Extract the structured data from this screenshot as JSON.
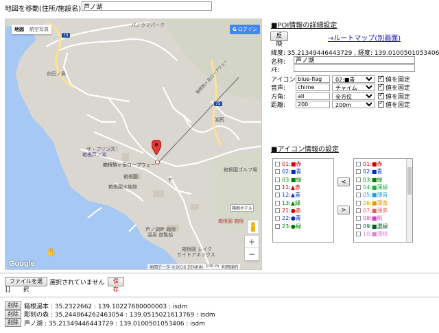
{
  "search": {
    "label": "地図を移動(住所/施設名):",
    "value": "芦ノ湖"
  },
  "map": {
    "type_buttons": [
      "地図",
      "航空写真"
    ],
    "login_label": "ログイン",
    "labels": {
      "panorama": "パノラマパーク",
      "road75a": "75",
      "road75b": "75",
      "wadanohana": "和田ノ鼻",
      "ropeway1": "箱根駒ヶ岳ロープウェー",
      "ropeway2": "箱根駒ヶ岳ロープウェー",
      "kojiri": "湖尻",
      "hotel1": "ザ・プリンス",
      "hotel2": "箱根芦ノ湖",
      "parking": "P",
      "hakonen": "箱根園",
      "aquarium": "箱根園水族館",
      "golf": "箱根園ゴルフ場",
      "hotel_hakone": "箱根ホテル",
      "keiyu": "箱根園 箱根",
      "ashinoko_onsen1": "芦ノ湖畔 箱根",
      "ashinoko_onsen2": "温泉 遊覧船",
      "lake_side1": "箱根園 レイク",
      "lake_side2": "サイドアネックス"
    },
    "zoom_in": "+",
    "zoom_out": "−",
    "google": "Google",
    "copyright": "地図データ ©2016 ZENRIN",
    "scale": "100 m",
    "terms": "利用規約",
    "pin_color": "#e53935"
  },
  "poi": {
    "title": "■POI情報の詳細設定",
    "apply_label": "反映",
    "route_link": "→ルートマップ(別画面)",
    "coords": "緯度: 35.21349446443729 , 経度: 139.0100501053406",
    "name_label": "名称:",
    "name_value": "芦ノ湖",
    "memo_label": "ﾒﾓ:",
    "memo_value": "",
    "rows": [
      {
        "label": "アイコン:",
        "input": "blue-flag",
        "select": "02:■青",
        "fix": "値を固定"
      },
      {
        "label": "音声:",
        "input": "chime",
        "select": "チャイム",
        "fix": "値を固定"
      },
      {
        "label": "方角:",
        "input": "all",
        "select": "全方位",
        "fix": "値を固定"
      },
      {
        "label": "距離:",
        "input": "200",
        "select": "200m",
        "fix": "値を固定"
      }
    ]
  },
  "icon": {
    "title": "■アイコン情報の設定",
    "left_list": [
      {
        "text": "01:■赤",
        "color": "#d00000"
      },
      {
        "text": "02:■青",
        "color": "#0030c0"
      },
      {
        "text": "03:■緑",
        "color": "#008000"
      },
      {
        "text": "11:▲赤",
        "color": "#d00000"
      },
      {
        "text": "12:▲青",
        "color": "#0030c0"
      },
      {
        "text": "13:▲緑",
        "color": "#008000"
      },
      {
        "text": "21:●赤",
        "color": "#d00000"
      },
      {
        "text": "22:●青",
        "color": "#0030c0"
      },
      {
        "text": "23:●緑",
        "color": "#008000"
      }
    ],
    "right_list": [
      {
        "text": "01:■赤",
        "color": "#d00000"
      },
      {
        "text": "02:■青",
        "color": "#0030c0"
      },
      {
        "text": "03:■緑",
        "color": "#008000"
      },
      {
        "text": "04:■薄緑",
        "color": "#20b040"
      },
      {
        "text": "05:■薄青",
        "color": "#20a0e0"
      },
      {
        "text": "06:■薄黄",
        "color": "#e0a000"
      },
      {
        "text": "07:■薄赤",
        "color": "#e06060"
      },
      {
        "text": "08:■桃",
        "color": "#d040c0"
      },
      {
        "text": "09:■濃緑",
        "color": "#006020"
      },
      {
        "text": "10:■薄桃",
        "color": "#e080d0"
      }
    ],
    "add_label": "<",
    "remove_label": ">"
  },
  "file": {
    "choose_label": "ファイルを選択",
    "status": "選択されていません",
    "save_label": "保存"
  },
  "bracket": "[]",
  "entries": [
    {
      "delete": "削除",
      "text": "箱根湯本 : 35.2322662 : 139.10227680000003 : isdm"
    },
    {
      "delete": "削除",
      "text": "彫刻の森 : 35.244864262463054 : 139.0515021613769 : isdm"
    },
    {
      "delete": "削除",
      "text": "芦ノ湖 : 35.21349446443729 : 139.0100501053406 : isdm"
    }
  ]
}
